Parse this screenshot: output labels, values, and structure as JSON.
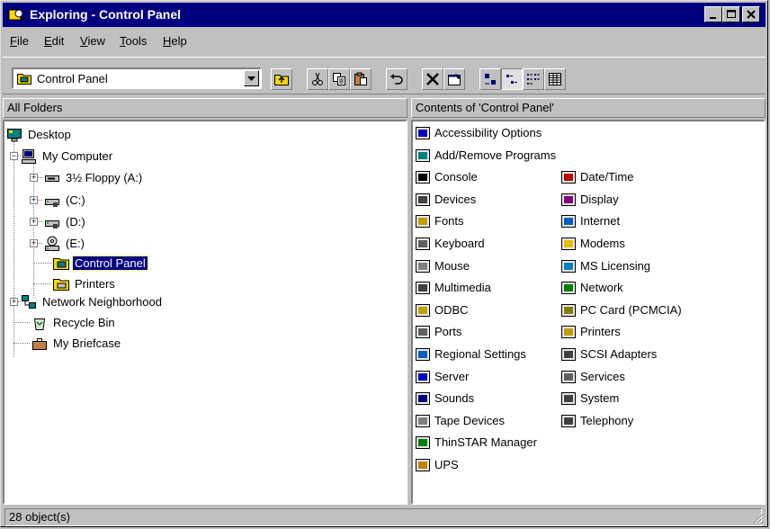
{
  "window": {
    "title": "Exploring - Control Panel"
  },
  "menu": [
    {
      "label": "File",
      "key": "F",
      "rest": "ile"
    },
    {
      "label": "Edit",
      "key": "E",
      "rest": "dit"
    },
    {
      "label": "View",
      "key": "V",
      "rest": "iew"
    },
    {
      "label": "Tools",
      "key": "T",
      "rest": "ools"
    },
    {
      "label": "Help",
      "key": "H",
      "rest": "elp"
    }
  ],
  "address": {
    "value": "Control Panel"
  },
  "left_pane": {
    "header": "All Folders",
    "tree": [
      {
        "label": "Desktop",
        "icon": "desktop-icon"
      },
      {
        "label": "My Computer",
        "icon": "computer-icon"
      },
      {
        "label": "3½ Floppy (A:)",
        "icon": "floppy-drive-icon"
      },
      {
        "label": "(C:)",
        "icon": "hard-drive-icon"
      },
      {
        "label": "(D:)",
        "icon": "hard-drive-icon"
      },
      {
        "label": "(E:)",
        "icon": "cdrom-drive-icon"
      },
      {
        "label": "Control Panel",
        "icon": "control-panel-folder-icon",
        "selected": true
      },
      {
        "label": "Printers",
        "icon": "printers-folder-icon"
      },
      {
        "label": "Network Neighborhood",
        "icon": "network-icon"
      },
      {
        "label": "Recycle Bin",
        "icon": "recycle-bin-icon"
      },
      {
        "label": "My Briefcase",
        "icon": "briefcase-icon"
      }
    ]
  },
  "right_pane": {
    "header": "Contents of 'Control Panel'",
    "items": [
      {
        "label": "Accessibility Options",
        "icon": "accessibility-icon",
        "color": "#0000c0"
      },
      {
        "label": "Add/Remove Programs",
        "icon": "add-remove-programs-icon",
        "color": "#008080"
      },
      {
        "label": "Console",
        "icon": "console-icon",
        "color": "#000000"
      },
      {
        "label": "Date/Time",
        "icon": "date-time-icon",
        "color": "#c00000"
      },
      {
        "label": "Devices",
        "icon": "devices-icon",
        "color": "#404040"
      },
      {
        "label": "Display",
        "icon": "display-icon",
        "color": "#800080"
      },
      {
        "label": "Fonts",
        "icon": "fonts-icon",
        "color": "#c0a000"
      },
      {
        "label": "Internet",
        "icon": "internet-icon",
        "color": "#0060c0"
      },
      {
        "label": "Keyboard",
        "icon": "keyboard-icon",
        "color": "#606060"
      },
      {
        "label": "Modems",
        "icon": "modems-icon",
        "color": "#e0c000"
      },
      {
        "label": "Mouse",
        "icon": "mouse-icon",
        "color": "#808080"
      },
      {
        "label": "MS Licensing",
        "icon": "ms-licensing-icon",
        "color": "#0080c0"
      },
      {
        "label": "Multimedia",
        "icon": "multimedia-icon",
        "color": "#404040"
      },
      {
        "label": "Network",
        "icon": "network-icon",
        "color": "#008000"
      },
      {
        "label": "ODBC",
        "icon": "odbc-icon",
        "color": "#c0a000"
      },
      {
        "label": "PC Card (PCMCIA)",
        "icon": "pc-card-icon",
        "color": "#808000"
      },
      {
        "label": "Ports",
        "icon": "ports-icon",
        "color": "#606060"
      },
      {
        "label": "Printers",
        "icon": "printers-icon",
        "color": "#c0a000"
      },
      {
        "label": "Regional Settings",
        "icon": "regional-settings-icon",
        "color": "#0060c0"
      },
      {
        "label": "SCSI Adapters",
        "icon": "scsi-adapters-icon",
        "color": "#404040"
      },
      {
        "label": "Server",
        "icon": "server-icon",
        "color": "#0000c0"
      },
      {
        "label": "Services",
        "icon": "services-icon",
        "color": "#606060"
      },
      {
        "label": "Sounds",
        "icon": "sounds-icon",
        "color": "#000080"
      },
      {
        "label": "System",
        "icon": "system-icon",
        "color": "#404040"
      },
      {
        "label": "Tape Devices",
        "icon": "tape-devices-icon",
        "color": "#808080"
      },
      {
        "label": "Telephony",
        "icon": "telephony-icon",
        "color": "#404040"
      },
      {
        "label": "ThinSTAR Manager",
        "icon": "thinstar-manager-icon",
        "color": "#008000"
      },
      {
        "label": "UPS",
        "icon": "ups-icon",
        "color": "#c08000"
      }
    ]
  },
  "status": {
    "text": "28 object(s)"
  }
}
